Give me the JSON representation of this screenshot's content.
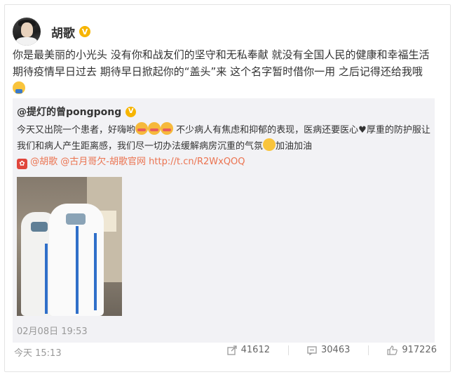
{
  "post": {
    "author": "胡歌",
    "verified_badge": "V",
    "text": "你是最美丽的小光头 没有你和战友们的坚守和无私奉献 就没有全国人民的健康和幸福生活 期待疫情早日过去 期待早日掀起你的“盖头”来 这个名字暂时借你一用 之后记得还给我哦",
    "time": "今天 15:13",
    "repost_count": "41612",
    "comment_count": "30463",
    "like_count": "917226"
  },
  "repost": {
    "author": "@提灯的曾pongpong",
    "text_part1": "今天又出院一个患者，好嗨哟",
    "text_part2": " 不少病人有焦虑和抑郁的表现，医病还要医心",
    "text_part3": "厚重的防护服让我们和病人产生距离感，我们尽一切办法缓解病房沉重的气氛",
    "text_part4": "加油加油",
    "mention1": "@胡歌",
    "mention2": "@古月哥欠-胡歌官网",
    "url": "http://t.cn/R2WxQOQ",
    "time": "02月08日 19:53"
  },
  "colors": {
    "link": "#eb7350",
    "badge": "#f7b500",
    "repost_bg": "#f2f2f5"
  },
  "icons": [
    "avatar",
    "verified-badge-icon",
    "emoji-icon",
    "heart-icon",
    "red-packet-icon",
    "repost-icon",
    "comment-icon",
    "like-icon"
  ]
}
